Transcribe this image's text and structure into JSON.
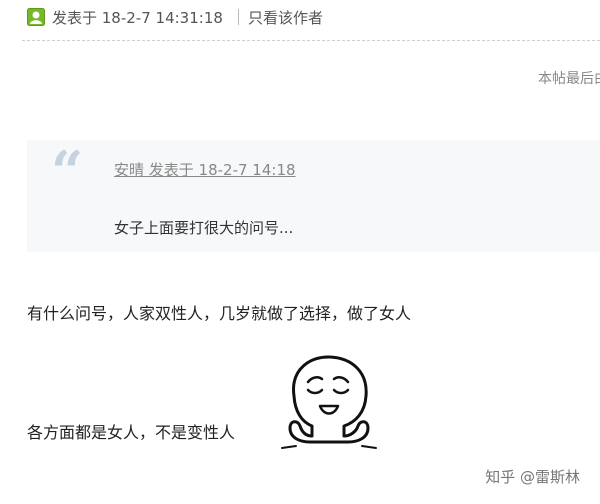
{
  "post_header": {
    "posted_at": "发表于 18-2-7 14:31:18",
    "author_only_link": "只看该作者",
    "online_icon": "online-status-icon"
  },
  "last_edited_text": "本帖最后由 ",
  "quote": {
    "meta": "安晴 发表于 18-2-7 14:18",
    "text": "女子上面要打很大的问号..."
  },
  "body_lines": [
    "有什么问号，人家双性人，几岁就做了选择，做了女人",
    "各方面都是女人，不是变性人"
  ],
  "sticker": "smug-face-sticker",
  "watermark": "知乎 @雷斯林",
  "colors": {
    "online_icon_green": "#76b82a",
    "quote_background": "#f7f8fa",
    "quote_mark": "#c6d2e2"
  }
}
